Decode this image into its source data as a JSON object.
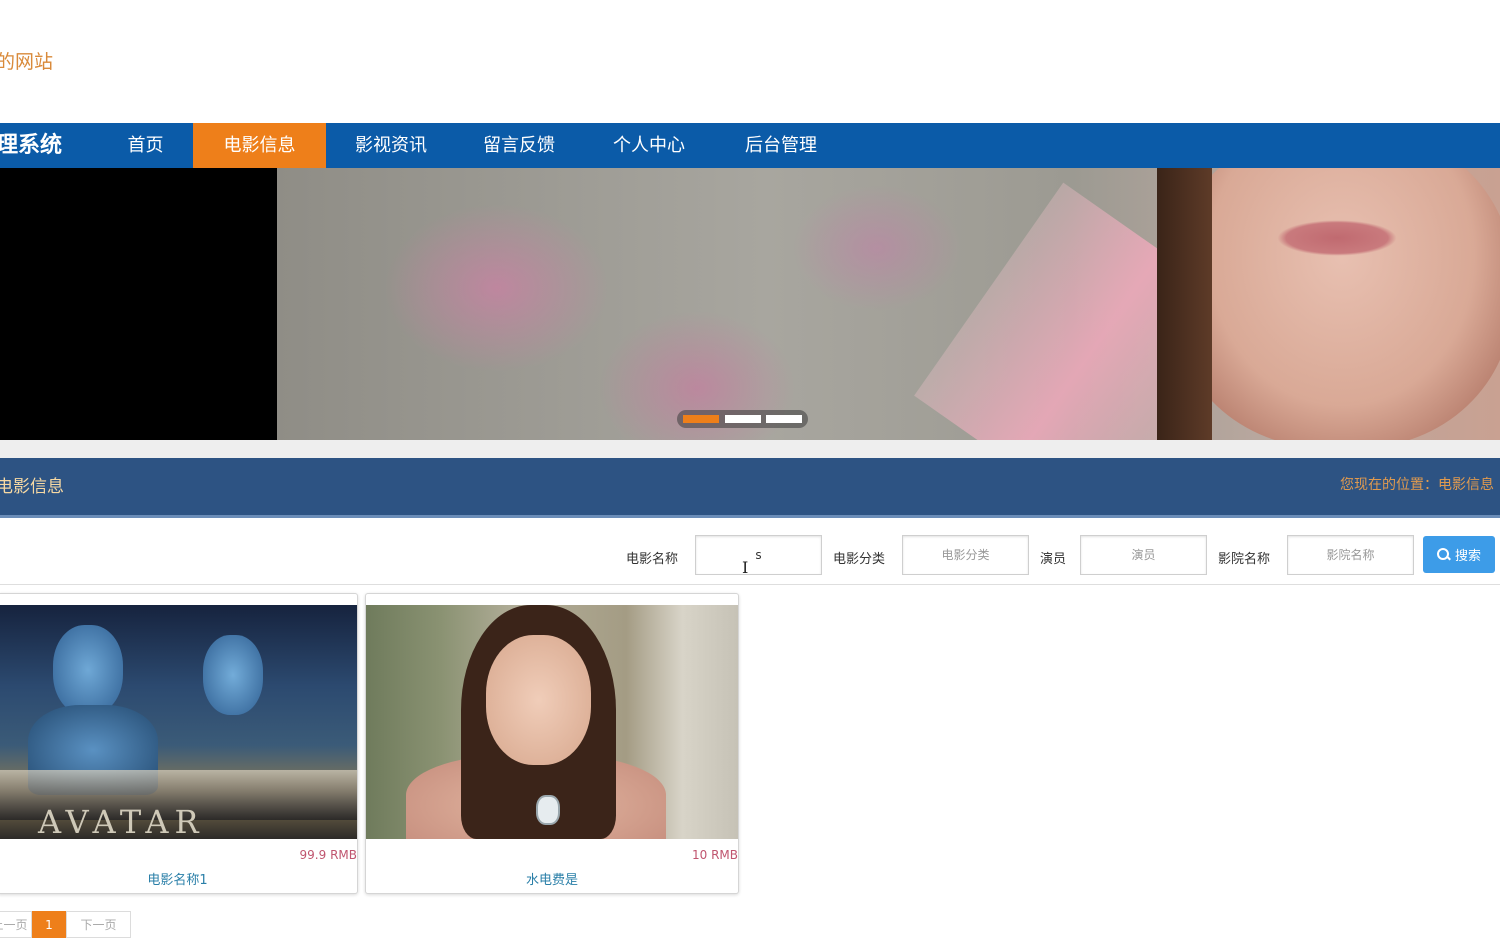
{
  "site": {
    "title": "的网站"
  },
  "navbar": {
    "brand": "理系统",
    "items": [
      {
        "label": "首页",
        "active": false
      },
      {
        "label": "电影信息",
        "active": true
      },
      {
        "label": "影视资讯",
        "active": false
      },
      {
        "label": "留言反馈",
        "active": false
      },
      {
        "label": "个人中心",
        "active": false
      },
      {
        "label": "后台管理",
        "active": false
      }
    ],
    "colors": {
      "background": "#0b5ba8",
      "active": "#ee7f1a"
    }
  },
  "banner": {
    "slide_count": 3,
    "active_slide": 1
  },
  "section": {
    "title": "电影信息",
    "breadcrumb": "您现在的位置：电影信息"
  },
  "search": {
    "fields": [
      {
        "label": "电影名称",
        "value": "s",
        "placeholder": ""
      },
      {
        "label": "电影分类",
        "value": "",
        "placeholder": "电影分类"
      },
      {
        "label": "演员",
        "value": "",
        "placeholder": "演员"
      },
      {
        "label": "影院名称",
        "value": "",
        "placeholder": "影院名称"
      }
    ],
    "button_label": "搜索",
    "button_icon": "search-icon",
    "button_color": "#3d9ce8"
  },
  "movies": [
    {
      "name": "电影名称1",
      "price": "99.9 RMB",
      "poster_text": "AVATAR"
    },
    {
      "name": "水电费是",
      "price": "10 RMB"
    }
  ],
  "pagination": {
    "prev_label": "上一页",
    "current_page": "1",
    "next_label": "下一页"
  }
}
